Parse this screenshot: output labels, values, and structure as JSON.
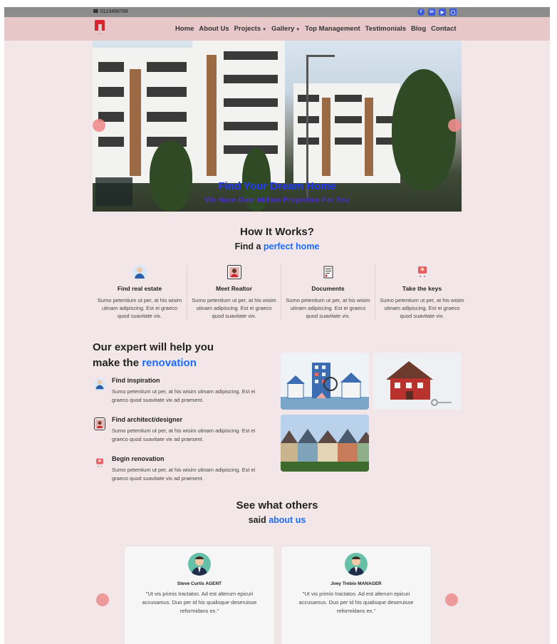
{
  "topbar": {
    "phone": "0123456789",
    "socials": [
      {
        "icon": "facebook-icon"
      },
      {
        "icon": "linkedin-icon"
      },
      {
        "icon": "youtube-icon"
      },
      {
        "icon": "instagram-icon"
      }
    ]
  },
  "nav": {
    "items": [
      "Home",
      "About Us",
      "Projects",
      "Gallery",
      "Top Management",
      "Testimonials",
      "Blog",
      "Contact"
    ],
    "dropdowns": [
      "Projects",
      "Gallery"
    ]
  },
  "hero": {
    "title": "Find Your Dream Home",
    "subtitle": "We Have Over Million Properties For You"
  },
  "how": {
    "title": "How It Works?",
    "subtitle_prefix": "Find a ",
    "subtitle_accent": "perfect home",
    "steps": [
      {
        "title": "Find real estate",
        "text": "Sumo petentium ut per, at his wisim utinam adipiscing. Est ei graeco quod suavitate vix."
      },
      {
        "title": "Meet Realtor",
        "text": "Sumo petentium ut per, at his wisim utinam adipiscing. Est ei graeco quod suavitate vix."
      },
      {
        "title": "Documents",
        "text": "Sumo petentium ut per, at his wisim utinam adipiscing. Est ei graeco quod suavitate vix."
      },
      {
        "title": "Take the keys",
        "text": "Sumo petentium ut per, at his wisim utinam adipiscing. Est ei graeco quod suavitate vix."
      }
    ]
  },
  "expert": {
    "title_line1": "Our expert will help you",
    "title_prefix": "make the ",
    "title_accent": "renovation",
    "features": [
      {
        "title": "Find inspiration",
        "text": "Sumo petentium ut per, at his wisim utinam adipiscing. Est ei graeco quod suavitate vix ad praesent."
      },
      {
        "title": "Find architect/designer",
        "text": "Sumo petentium ut per, at his wisim utinam adipiscing. Est ei graeco quod suavitate vix ad praesent."
      },
      {
        "title": "Begin renovation",
        "text": "Sumo petentium ut per, at his wisim utinam adipiscing. Est ei graeco quod suavitate vix ad praesent."
      }
    ]
  },
  "testimonials": {
    "title": "See what others",
    "subtitle_prefix": "said ",
    "subtitle_accent": "about us",
    "cards": [
      {
        "name": "Steve Curtis",
        "role": "AGENT",
        "quote": "\"Ut vis primis tractatos. Ad est alterum epicuri accusamus. Duo per id his qualisque deseruisse reformidans ex.\""
      },
      {
        "name": "Joey Trebio",
        "role": "MANAGER",
        "quote": "\"Ut vis primis tractatos. Ad est alterum epicuri accusamus. Duo per id his qualisque deseruisse reformidans ex.\""
      }
    ]
  },
  "colors": {
    "accent": "#1a6cff",
    "page_bg": "#f3e6e8",
    "navbar_bg": "#e7c7c8",
    "arrow": "#ef9a9a"
  }
}
